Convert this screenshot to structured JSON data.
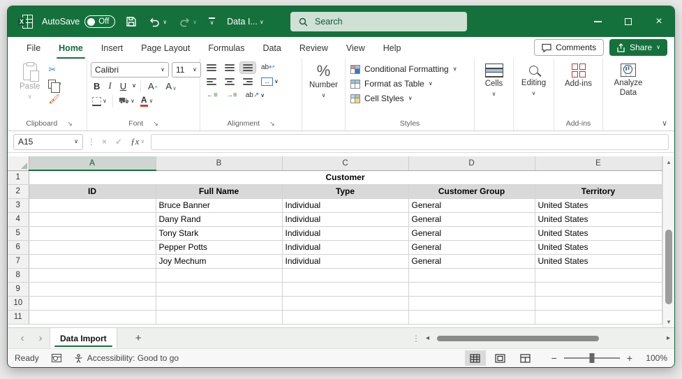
{
  "titlebar": {
    "autosave_label": "AutoSave",
    "autosave_state": "Off",
    "doc_title": "Data I...",
    "search_placeholder": "Search"
  },
  "ribbon": {
    "tabs": [
      {
        "label": "File",
        "active": false
      },
      {
        "label": "Home",
        "active": true
      },
      {
        "label": "Insert",
        "active": false
      },
      {
        "label": "Page Layout",
        "active": false
      },
      {
        "label": "Formulas",
        "active": false
      },
      {
        "label": "Data",
        "active": false
      },
      {
        "label": "Review",
        "active": false
      },
      {
        "label": "View",
        "active": false
      },
      {
        "label": "Help",
        "active": false
      }
    ],
    "comments_label": "Comments",
    "share_label": "Share",
    "clipboard": {
      "label": "Clipboard",
      "paste_label": "Paste"
    },
    "font": {
      "label": "Font",
      "font_name": "Calibri",
      "font_size": "11"
    },
    "alignment": {
      "label": "Alignment"
    },
    "number": {
      "label": "Number"
    },
    "styles": {
      "label": "Styles",
      "items": [
        "Conditional Formatting",
        "Format as Table",
        "Cell Styles"
      ]
    },
    "cells": {
      "label": "Cells"
    },
    "editing": {
      "label": "Editing"
    },
    "addins": {
      "button_label": "Add-ins",
      "group_label": "Add-ins"
    },
    "analyze": {
      "label_line1": "Analyze",
      "label_line2": "Data"
    }
  },
  "formula_bar": {
    "name_box": "A15",
    "value": ""
  },
  "sheet": {
    "columns": [
      "A",
      "B",
      "C",
      "D",
      "E"
    ],
    "selected_column": "A",
    "row_count": 11,
    "title_cell": "Customer",
    "header_row": [
      "ID",
      "Full Name",
      "Type",
      "Customer Group",
      "Territory"
    ],
    "data_rows": [
      [
        "",
        "Bruce Banner",
        "Individual",
        "General",
        "United States"
      ],
      [
        "",
        "Dany Rand",
        "Individual",
        "General",
        "United States"
      ],
      [
        "",
        "Tony Stark",
        "Individual",
        "General",
        "United States"
      ],
      [
        "",
        "Pepper Potts",
        "Individual",
        "General",
        "United States"
      ],
      [
        "",
        "Joy Mechum",
        "Individual",
        "General",
        "United States"
      ]
    ]
  },
  "tab_bar": {
    "tabs": [
      {
        "label": "Data Import",
        "active": true
      }
    ],
    "add_label": "+"
  },
  "status_bar": {
    "ready_label": "Ready",
    "accessibility_label": "Accessibility: Good to go",
    "zoom_level": "100%"
  },
  "colors": {
    "titlebar_green": "#15713b",
    "accent_green": "#217346",
    "header_row_fill": "#d9d9d9",
    "font_color_swatch": "#d03a31"
  }
}
